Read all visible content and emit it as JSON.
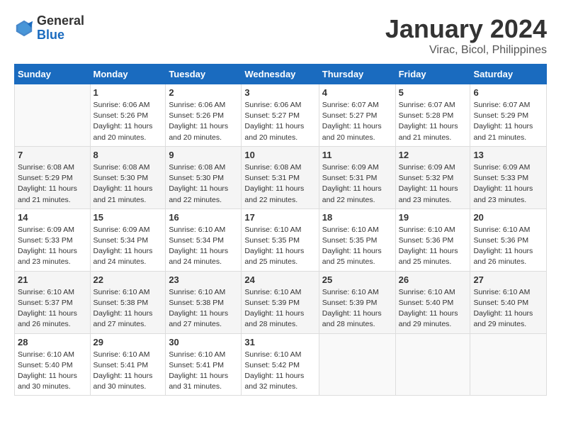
{
  "header": {
    "logo_general": "General",
    "logo_blue": "Blue",
    "month_year": "January 2024",
    "location": "Virac, Bicol, Philippines"
  },
  "weekdays": [
    "Sunday",
    "Monday",
    "Tuesday",
    "Wednesday",
    "Thursday",
    "Friday",
    "Saturday"
  ],
  "weeks": [
    [
      {
        "day": "",
        "sunrise": "",
        "sunset": "",
        "daylight": "",
        "empty": true
      },
      {
        "day": "1",
        "sunrise": "6:06 AM",
        "sunset": "5:26 PM",
        "daylight": "11 hours and 20 minutes."
      },
      {
        "day": "2",
        "sunrise": "6:06 AM",
        "sunset": "5:26 PM",
        "daylight": "11 hours and 20 minutes."
      },
      {
        "day": "3",
        "sunrise": "6:06 AM",
        "sunset": "5:27 PM",
        "daylight": "11 hours and 20 minutes."
      },
      {
        "day": "4",
        "sunrise": "6:07 AM",
        "sunset": "5:27 PM",
        "daylight": "11 hours and 20 minutes."
      },
      {
        "day": "5",
        "sunrise": "6:07 AM",
        "sunset": "5:28 PM",
        "daylight": "11 hours and 21 minutes."
      },
      {
        "day": "6",
        "sunrise": "6:07 AM",
        "sunset": "5:29 PM",
        "daylight": "11 hours and 21 minutes."
      }
    ],
    [
      {
        "day": "7",
        "sunrise": "6:08 AM",
        "sunset": "5:29 PM",
        "daylight": "11 hours and 21 minutes."
      },
      {
        "day": "8",
        "sunrise": "6:08 AM",
        "sunset": "5:30 PM",
        "daylight": "11 hours and 21 minutes."
      },
      {
        "day": "9",
        "sunrise": "6:08 AM",
        "sunset": "5:30 PM",
        "daylight": "11 hours and 22 minutes."
      },
      {
        "day": "10",
        "sunrise": "6:08 AM",
        "sunset": "5:31 PM",
        "daylight": "11 hours and 22 minutes."
      },
      {
        "day": "11",
        "sunrise": "6:09 AM",
        "sunset": "5:31 PM",
        "daylight": "11 hours and 22 minutes."
      },
      {
        "day": "12",
        "sunrise": "6:09 AM",
        "sunset": "5:32 PM",
        "daylight": "11 hours and 23 minutes."
      },
      {
        "day": "13",
        "sunrise": "6:09 AM",
        "sunset": "5:33 PM",
        "daylight": "11 hours and 23 minutes."
      }
    ],
    [
      {
        "day": "14",
        "sunrise": "6:09 AM",
        "sunset": "5:33 PM",
        "daylight": "11 hours and 23 minutes."
      },
      {
        "day": "15",
        "sunrise": "6:09 AM",
        "sunset": "5:34 PM",
        "daylight": "11 hours and 24 minutes."
      },
      {
        "day": "16",
        "sunrise": "6:10 AM",
        "sunset": "5:34 PM",
        "daylight": "11 hours and 24 minutes."
      },
      {
        "day": "17",
        "sunrise": "6:10 AM",
        "sunset": "5:35 PM",
        "daylight": "11 hours and 25 minutes."
      },
      {
        "day": "18",
        "sunrise": "6:10 AM",
        "sunset": "5:35 PM",
        "daylight": "11 hours and 25 minutes."
      },
      {
        "day": "19",
        "sunrise": "6:10 AM",
        "sunset": "5:36 PM",
        "daylight": "11 hours and 25 minutes."
      },
      {
        "day": "20",
        "sunrise": "6:10 AM",
        "sunset": "5:36 PM",
        "daylight": "11 hours and 26 minutes."
      }
    ],
    [
      {
        "day": "21",
        "sunrise": "6:10 AM",
        "sunset": "5:37 PM",
        "daylight": "11 hours and 26 minutes."
      },
      {
        "day": "22",
        "sunrise": "6:10 AM",
        "sunset": "5:38 PM",
        "daylight": "11 hours and 27 minutes."
      },
      {
        "day": "23",
        "sunrise": "6:10 AM",
        "sunset": "5:38 PM",
        "daylight": "11 hours and 27 minutes."
      },
      {
        "day": "24",
        "sunrise": "6:10 AM",
        "sunset": "5:39 PM",
        "daylight": "11 hours and 28 minutes."
      },
      {
        "day": "25",
        "sunrise": "6:10 AM",
        "sunset": "5:39 PM",
        "daylight": "11 hours and 28 minutes."
      },
      {
        "day": "26",
        "sunrise": "6:10 AM",
        "sunset": "5:40 PM",
        "daylight": "11 hours and 29 minutes."
      },
      {
        "day": "27",
        "sunrise": "6:10 AM",
        "sunset": "5:40 PM",
        "daylight": "11 hours and 29 minutes."
      }
    ],
    [
      {
        "day": "28",
        "sunrise": "6:10 AM",
        "sunset": "5:40 PM",
        "daylight": "11 hours and 30 minutes."
      },
      {
        "day": "29",
        "sunrise": "6:10 AM",
        "sunset": "5:41 PM",
        "daylight": "11 hours and 30 minutes."
      },
      {
        "day": "30",
        "sunrise": "6:10 AM",
        "sunset": "5:41 PM",
        "daylight": "11 hours and 31 minutes."
      },
      {
        "day": "31",
        "sunrise": "6:10 AM",
        "sunset": "5:42 PM",
        "daylight": "11 hours and 32 minutes."
      },
      {
        "day": "",
        "sunrise": "",
        "sunset": "",
        "daylight": "",
        "empty": true
      },
      {
        "day": "",
        "sunrise": "",
        "sunset": "",
        "daylight": "",
        "empty": true
      },
      {
        "day": "",
        "sunrise": "",
        "sunset": "",
        "daylight": "",
        "empty": true
      }
    ]
  ],
  "labels": {
    "sunrise_prefix": "Sunrise: ",
    "sunset_prefix": "Sunset: ",
    "daylight_prefix": "Daylight: "
  }
}
